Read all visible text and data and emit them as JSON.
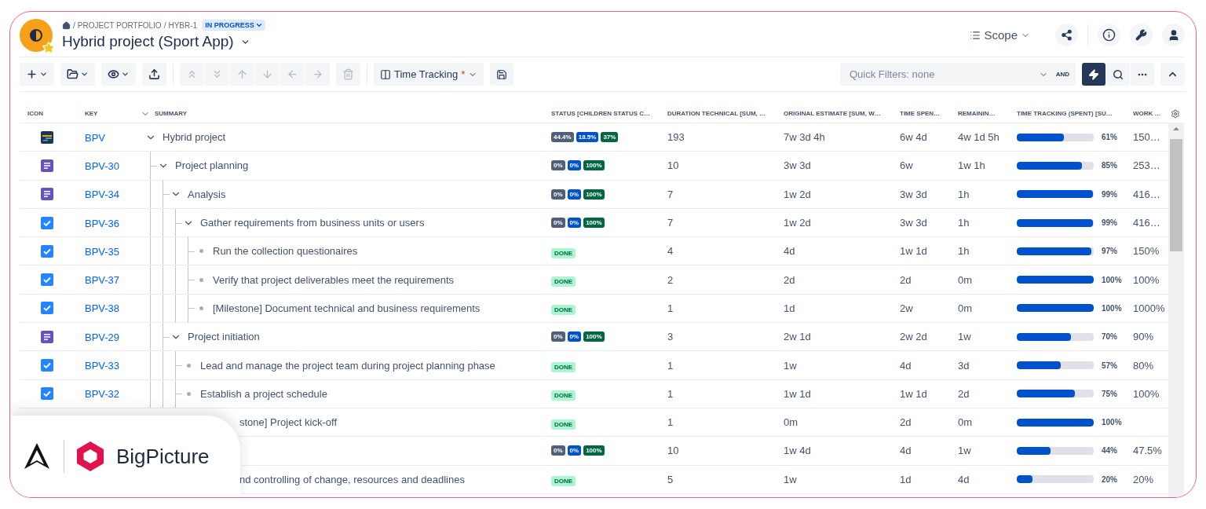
{
  "header": {
    "favorite": true,
    "breadcrumb": {
      "separator": "/",
      "items": [
        "PROJECT PORTFOLIO",
        "HYBR-1"
      ]
    },
    "status": "IN PROGRESS",
    "title": "Hybrid project (Sport App)",
    "scope": "Scope"
  },
  "toolbar": {
    "actions": [
      {
        "has_menu": true,
        "disabled": false
      },
      {
        "has_menu": true,
        "disabled": false
      },
      {
        "has_menu": true,
        "disabled": false
      },
      {
        "has_menu": false,
        "disabled": false
      }
    ],
    "moves": [
      {
        "disabled": true
      },
      {
        "disabled": true
      },
      {
        "disabled": true
      },
      {
        "disabled": true
      },
      {
        "disabled": true
      },
      {
        "disabled": true
      }
    ],
    "delete": {
      "disabled": true
    },
    "view": {
      "label": "Time Tracking",
      "modified_mark": "*"
    },
    "quick_filters": {
      "placeholder": "Quick Filters: none",
      "operator": "AND"
    },
    "tools": [
      {
        "selected": true
      },
      {
        "selected": false
      },
      {
        "selected": false
      }
    ]
  },
  "table": {
    "columns": [
      "ICON",
      "KEY",
      "SUMMARY",
      "STATUS [CHILDREN STATUS C…",
      "DURATION TECHNICAL [SUM, …",
      "ORIGINAL ESTIMATE [SUM, W…",
      "TIME SPEN…",
      "REMAININ…",
      "TIME TRACKING (SPENT) [SU…",
      "WORK …"
    ],
    "rows": [
      {
        "kind": "project",
        "key": "BPV",
        "summary": "Hybrid project",
        "expanded": true,
        "status": {
          "kind": "chips",
          "chips": [
            {
              "text": "44.4%",
              "color": "#505f79"
            },
            {
              "text": "18.5%",
              "color": "#0052cc"
            },
            {
              "text": "37%",
              "color": "#006644"
            }
          ]
        },
        "duration": "193",
        "estimate": "7w 3d 4h",
        "spent": "6w 4d",
        "remaining": "4w 1d 5h",
        "tracking": {
          "level": 0.61,
          "text": "61%"
        },
        "work": "150…",
        "children": [
          {
            "kind": "story",
            "key": "BPV-30",
            "summary": "Project planning",
            "expanded": true,
            "status": {
              "kind": "chips",
              "chips": [
                {
                  "text": "0%",
                  "color": "#505f79"
                },
                {
                  "text": "0%",
                  "color": "#0052cc"
                },
                {
                  "text": "100%",
                  "color": "#006644"
                }
              ]
            },
            "duration": "10",
            "estimate": "3w 3d",
            "spent": "6w",
            "remaining": "1w 1h",
            "tracking": {
              "level": 0.85,
              "text": "85%"
            },
            "work": "253…",
            "children": [
              {
                "kind": "story",
                "key": "BPV-34",
                "summary": "Analysis",
                "expanded": true,
                "status": {
                  "kind": "chips",
                  "chips": [
                    {
                      "text": "0%",
                      "color": "#505f79"
                    },
                    {
                      "text": "0%",
                      "color": "#0052cc"
                    },
                    {
                      "text": "100%",
                      "color": "#006644"
                    }
                  ]
                },
                "duration": "7",
                "estimate": "1w 2d",
                "spent": "3w 3d",
                "remaining": "1h",
                "tracking": {
                  "level": 0.99,
                  "text": "99%"
                },
                "work": "416…",
                "children": [
                  {
                    "kind": "task",
                    "key": "BPV-36",
                    "summary": "Gather requirements from business units or users",
                    "expanded": true,
                    "status": {
                      "kind": "chips",
                      "chips": [
                        {
                          "text": "0%",
                          "color": "#505f79"
                        },
                        {
                          "text": "0%",
                          "color": "#0052cc"
                        },
                        {
                          "text": "100%",
                          "color": "#006644"
                        }
                      ]
                    },
                    "duration": "7",
                    "estimate": "1w 2d",
                    "spent": "3w 3d",
                    "remaining": "1h",
                    "tracking": {
                      "level": 0.99,
                      "text": "99%"
                    },
                    "work": "416…",
                    "children": [
                      {
                        "kind": "task",
                        "key": "BPV-35",
                        "summary": "Run the collection questionaires",
                        "status": {
                          "kind": "lozenge",
                          "text": "DONE"
                        },
                        "duration": "4",
                        "estimate": "4d",
                        "spent": "1w 1d",
                        "remaining": "1h",
                        "tracking": {
                          "level": 0.97,
                          "text": "97%"
                        },
                        "work": "150%"
                      },
                      {
                        "kind": "task",
                        "key": "BPV-37",
                        "summary": "Verify that project deliverables meet the requirements",
                        "status": {
                          "kind": "lozenge",
                          "text": "DONE"
                        },
                        "duration": "2",
                        "estimate": "2d",
                        "spent": "2d",
                        "remaining": "0m",
                        "tracking": {
                          "level": 1,
                          "text": "100%"
                        },
                        "work": "100%"
                      },
                      {
                        "kind": "task",
                        "key": "BPV-38",
                        "summary": "[Milestone] Document technical and business requirements",
                        "status": {
                          "kind": "lozenge",
                          "text": "DONE"
                        },
                        "duration": "1",
                        "estimate": "1d",
                        "spent": "2w",
                        "remaining": "0m",
                        "tracking": {
                          "level": 1,
                          "text": "100%"
                        },
                        "work": "1000%"
                      }
                    ]
                  }
                ]
              },
              {
                "kind": "story",
                "key": "BPV-29",
                "summary": "Project initiation",
                "expanded": true,
                "status": {
                  "kind": "chips",
                  "chips": [
                    {
                      "text": "0%",
                      "color": "#505f79"
                    },
                    {
                      "text": "0%",
                      "color": "#0052cc"
                    },
                    {
                      "text": "100%",
                      "color": "#006644"
                    }
                  ]
                },
                "duration": "3",
                "estimate": "2w 1d",
                "spent": "2w 2d",
                "remaining": "1w",
                "tracking": {
                  "level": 0.7,
                  "text": "70%"
                },
                "work": "90%",
                "children": [
                  {
                    "kind": "task",
                    "key": "BPV-33",
                    "summary": "Lead and manage the project team during project planning phase",
                    "status": {
                      "kind": "lozenge",
                      "text": "DONE"
                    },
                    "duration": "1",
                    "estimate": "1w",
                    "spent": "4d",
                    "remaining": "3d",
                    "tracking": {
                      "level": 0.57,
                      "text": "57%"
                    },
                    "work": "80%"
                  },
                  {
                    "kind": "task",
                    "key": "BPV-32",
                    "summary": "Establish a project schedule",
                    "status": {
                      "kind": "lozenge",
                      "text": "DONE"
                    },
                    "duration": "1",
                    "estimate": "1w 1d",
                    "spent": "1w 1d",
                    "remaining": "2d",
                    "tracking": {
                      "level": 0.75,
                      "text": "75%"
                    },
                    "work": "100%"
                  },
                  {
                    "summary": "stone] Project kick-off",
                    "status": {
                      "kind": "lozenge",
                      "text": "DONE"
                    },
                    "duration": "1",
                    "estimate": "0m",
                    "spent": "2d",
                    "remaining": "0m",
                    "tracking": {
                      "level": 1,
                      "text": "100%"
                    }
                  }
                ]
              },
              {
                "status": {
                  "kind": "chips",
                  "chips": [
                    {
                      "text": "0%",
                      "color": "#505f79"
                    },
                    {
                      "text": "0%",
                      "color": "#0052cc"
                    },
                    {
                      "text": "100%",
                      "color": "#006644"
                    }
                  ]
                },
                "duration": "10",
                "estimate": "1w 4d",
                "spent": "4d",
                "remaining": "1w",
                "tracking": {
                  "level": 0.44,
                  "text": "44%"
                },
                "work": "47.5%",
                "children": [
                  {
                    "summary": "nd controlling of change, resources and deadlines",
                    "status": {
                      "kind": "lozenge",
                      "text": "DONE"
                    },
                    "duration": "5",
                    "estimate": "1w",
                    "spent": "1d",
                    "remaining": "4d",
                    "tracking": {
                      "level": 0.2,
                      "text": "20%"
                    },
                    "work": "20%"
                  }
                ]
              }
            ]
          }
        ]
      }
    ]
  },
  "brand_badge": {
    "text": "BigPicture"
  }
}
